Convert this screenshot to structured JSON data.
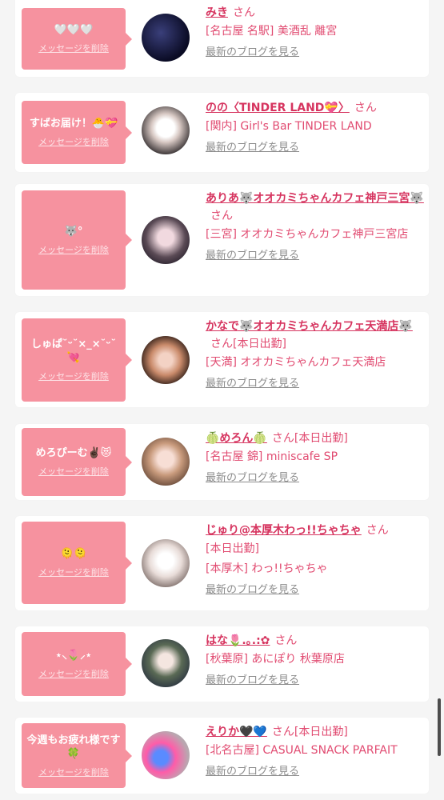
{
  "labels": {
    "delete": "メッセージを削除",
    "blog": "最新のブログを見る",
    "san": "さん"
  },
  "cards": [
    {
      "message": "🤍🤍🤍",
      "name": "みき",
      "suffix": "",
      "lines": [
        "[名古屋 名駅] 美酒乱 離宮"
      ]
    },
    {
      "message": "すばお届け！🐣💝",
      "name": "のの〈TINDER LAND💝〉",
      "suffix": "",
      "lines": [
        "[関内] Girl's Bar TINDER LAND"
      ]
    },
    {
      "message": "🐺°",
      "name": "ありあ🐺オオカミちゃんカフェ神戸三宮🐺",
      "suffix": "",
      "lines": [
        "[三宮] オオカミちゃんカフェ神戸三宮店"
      ]
    },
    {
      "message": "しゅぱ˘ᵕ˘×_×˘ᵕ˘💘",
      "name": "かなで🐺オオカミちゃんカフェ天満店🐺",
      "suffix": "[本日出勤]",
      "lines": [
        "[天満] オオカミちゃんカフェ天満店"
      ]
    },
    {
      "message": "めろぴーむ✌🏿😻",
      "name": "🍈めろん🍈",
      "suffix": "[本日出勤]",
      "lines": [
        "[名古屋 錦] miniscafe SP"
      ]
    },
    {
      "message": "🫠🫠",
      "name": "じゅり@本厚木わっ!!ちゃちゃ",
      "suffix": "",
      "lines": [
        "[本日出勤]",
        "[本厚木] わっ!!ちゃちゃ"
      ]
    },
    {
      "message": "⋆⸜🌷⸝⋆",
      "name": "はな🌷.｡.:✿",
      "suffix": "",
      "lines": [
        "[秋葉原] あにぽり 秋葉原店"
      ]
    },
    {
      "message": "今週もお疲れ様です🍀",
      "name": "えりか🖤💙",
      "suffix": "[本日出勤]",
      "lines": [
        "[北名古屋] CASUAL SNACK PARFAIT"
      ]
    }
  ],
  "colors": {
    "accent": "#f6929f",
    "name": "#d6345f",
    "text": "#e14b71",
    "link_gray": "#8c8c8c",
    "background": "#f5f5f5"
  }
}
